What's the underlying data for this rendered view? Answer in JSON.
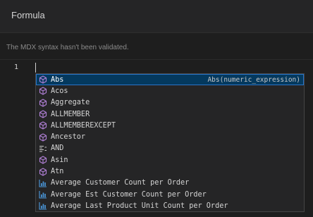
{
  "header": {
    "title": "Formula"
  },
  "validation": {
    "message": "The MDX syntax hasn't been validated."
  },
  "editor": {
    "line_number": "1"
  },
  "suggestions": {
    "items": [
      {
        "label": "Abs",
        "icon": "function-cube-icon",
        "detail": "Abs(numeric_expression)",
        "selected": true
      },
      {
        "label": "Acos",
        "icon": "function-cube-icon"
      },
      {
        "label": "Aggregate",
        "icon": "function-cube-icon"
      },
      {
        "label": "ALLMEMBER",
        "icon": "function-cube-icon"
      },
      {
        "label": "ALLMEMBEREXCEPT",
        "icon": "function-cube-icon"
      },
      {
        "label": "Ancestor",
        "icon": "function-cube-icon"
      },
      {
        "label": "AND",
        "icon": "operator-icon"
      },
      {
        "label": "Asin",
        "icon": "function-cube-icon"
      },
      {
        "label": "Atn",
        "icon": "function-cube-icon"
      },
      {
        "label": "Average Customer Count per Order",
        "icon": "measure-icon"
      },
      {
        "label": "Average Est Customer Count per Order",
        "icon": "measure-icon"
      },
      {
        "label": "Average Last Product Unit Count per Order",
        "icon": "measure-icon"
      }
    ]
  },
  "colors": {
    "function_icon": "#b180d7",
    "measure_icon": "#4b9be0",
    "selection": "#04395e"
  }
}
